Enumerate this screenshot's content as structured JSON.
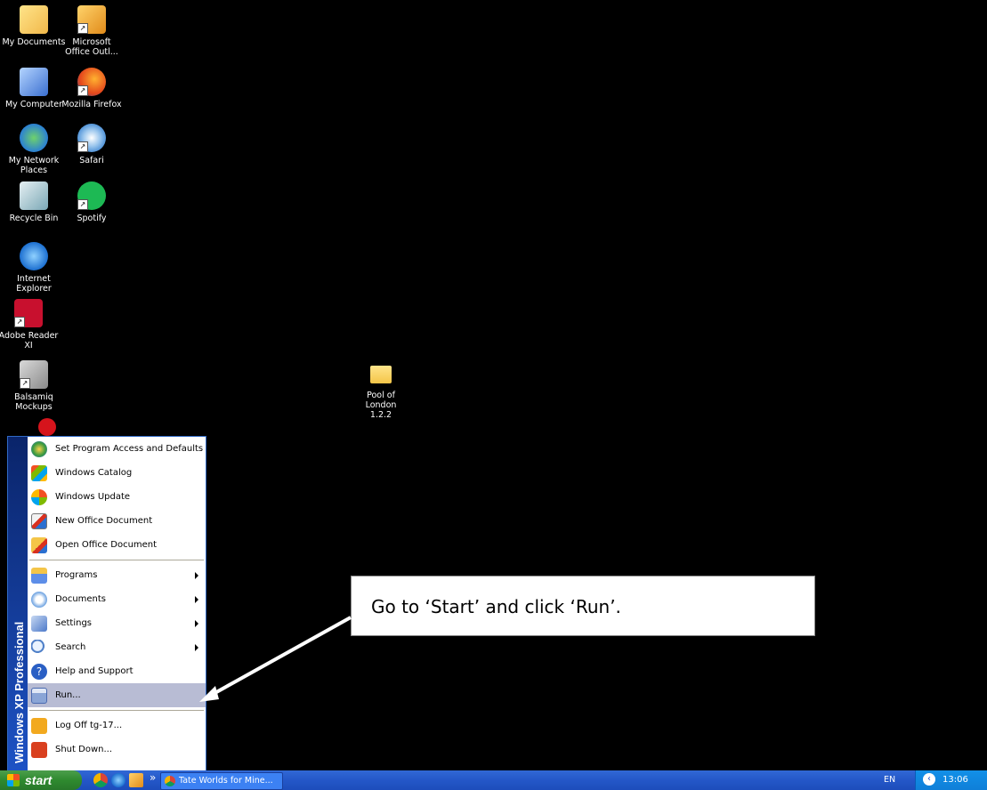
{
  "desktop": {
    "icons": [
      {
        "label": "My Documents",
        "icon": "folder-documents-icon"
      },
      {
        "label": "Microsoft Office Outl...",
        "icon": "outlook-icon"
      },
      {
        "label": "My Computer",
        "icon": "computer-icon"
      },
      {
        "label": "Mozilla Firefox",
        "icon": "firefox-icon"
      },
      {
        "label": "My Network Places",
        "icon": "network-icon"
      },
      {
        "label": "Safari",
        "icon": "safari-icon"
      },
      {
        "label": "Recycle Bin",
        "icon": "recycle-bin-icon"
      },
      {
        "label": "Spotify",
        "icon": "spotify-icon"
      },
      {
        "label": "Internet Explorer",
        "icon": "ie-icon"
      },
      {
        "label": "Adobe Reader XI",
        "icon": "adobe-reader-icon"
      },
      {
        "label": "Balsamiq Mockups",
        "icon": "balsamiq-icon"
      },
      {
        "label": "Pool of London 1.2.2",
        "icon": "folder-icon"
      }
    ]
  },
  "start_menu": {
    "sidebar_label": "Windows XP Professional",
    "items": [
      {
        "label": "Set Program Access and Defaults",
        "icon": "program-access-icon"
      },
      {
        "label": "Windows Catalog",
        "icon": "catalog-icon"
      },
      {
        "label": "Windows Update",
        "icon": "update-icon"
      },
      {
        "label": "New Office Document",
        "icon": "new-office-doc-icon"
      },
      {
        "label": "Open Office Document",
        "icon": "open-office-doc-icon"
      },
      {
        "label": "Programs",
        "icon": "programs-icon",
        "submenu": true
      },
      {
        "label": "Documents",
        "icon": "documents-icon",
        "submenu": true
      },
      {
        "label": "Settings",
        "icon": "settings-icon",
        "submenu": true
      },
      {
        "label": "Search",
        "icon": "search-icon",
        "submenu": true
      },
      {
        "label": "Help and Support",
        "icon": "help-icon"
      },
      {
        "label": "Run...",
        "icon": "run-icon",
        "highlighted": true
      },
      {
        "label": "Log Off tg-17...",
        "icon": "logoff-icon"
      },
      {
        "label": "Shut Down...",
        "icon": "shutdown-icon"
      }
    ]
  },
  "taskbar": {
    "start_label": "start",
    "quick_launch_more": "»",
    "task_button_label": "Tate Worlds for Mine...",
    "language": "EN",
    "clock": "13:06"
  },
  "callout": {
    "text": "Go to ‘Start’ and click ‘Run’."
  },
  "colors": {
    "desktop": "#000000",
    "taskbar": "#2457c8",
    "start_button": "#2f8a2f",
    "menu_sidebar": "#1d52c4",
    "menu_highlight": "#b8bcd4"
  }
}
